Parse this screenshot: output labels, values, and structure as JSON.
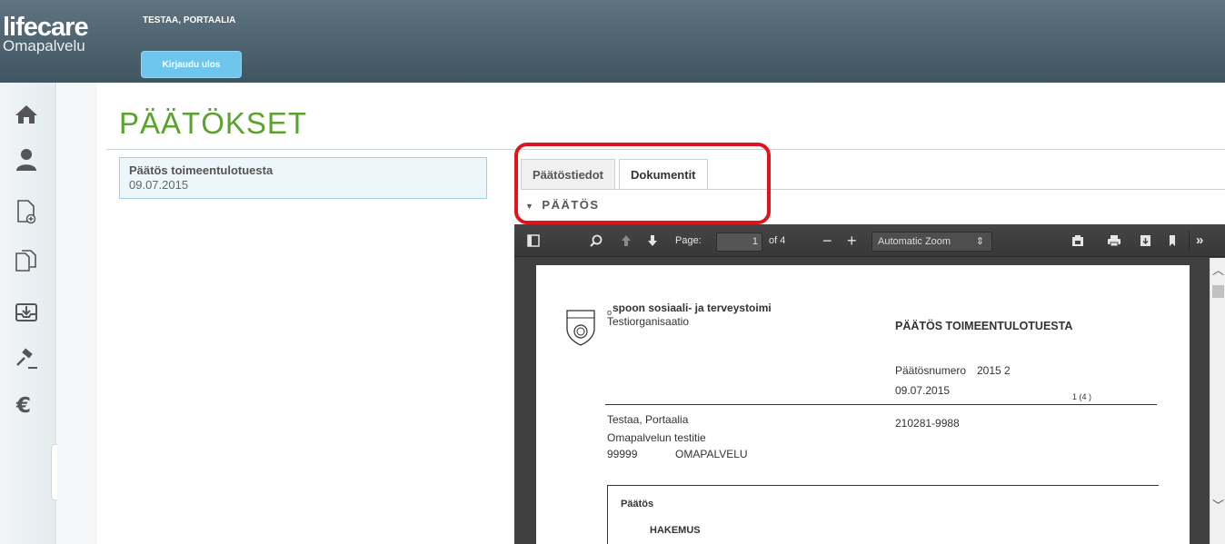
{
  "header": {
    "logo_main": "lifecare",
    "logo_sub": "Omapalvelu",
    "user_name": "TESTAA, PORTAALIA",
    "logout_label": "Kirjaudu ulos"
  },
  "sidebar": {
    "items": [
      {
        "name": "home-icon"
      },
      {
        "name": "person-icon"
      },
      {
        "name": "new-document-icon"
      },
      {
        "name": "documents-icon"
      },
      {
        "name": "inbox-icon"
      },
      {
        "name": "gavel-icon"
      },
      {
        "name": "euro-icon"
      }
    ]
  },
  "main": {
    "title": "PÄÄTÖKSET",
    "decision": {
      "title": "Päätös toimeentulotuesta",
      "date": "09.07.2015"
    },
    "tabs": [
      {
        "label": "Päätöstiedot"
      },
      {
        "label": "Dokumentit"
      }
    ],
    "section_label": "PÄÄTÖS"
  },
  "viewer": {
    "page_label": "Page:",
    "page_value": "1",
    "page_total": "of 4",
    "zoom_value": "Automatic Zoom"
  },
  "pdf": {
    "org_line1_prefix": "o",
    "org_line1": "spoon sosiaali- ja terveystoimi",
    "org_line2": "Testiorganisaatio",
    "doc_title": "PÄÄTÖS TOIMEENTULOTUESTA",
    "number_label": "Päätösnumero",
    "number_value": "2015 2",
    "date": "09.07.2015",
    "page_marker": "1 (4 )",
    "recipient_name": "Testaa, Portaalia",
    "recipient_street": "Omapalvelun testitie",
    "recipient_zip": "99999",
    "recipient_city": "OMAPALVELU",
    "id_code": "210281-9988",
    "box_heading": "Päätös",
    "box_sub": "HAKEMUS"
  },
  "colors": {
    "header_bg": "#4d626e",
    "title_green": "#5aa32e",
    "logout_blue": "#6ec6ec",
    "highlight_red": "#e0141b"
  }
}
